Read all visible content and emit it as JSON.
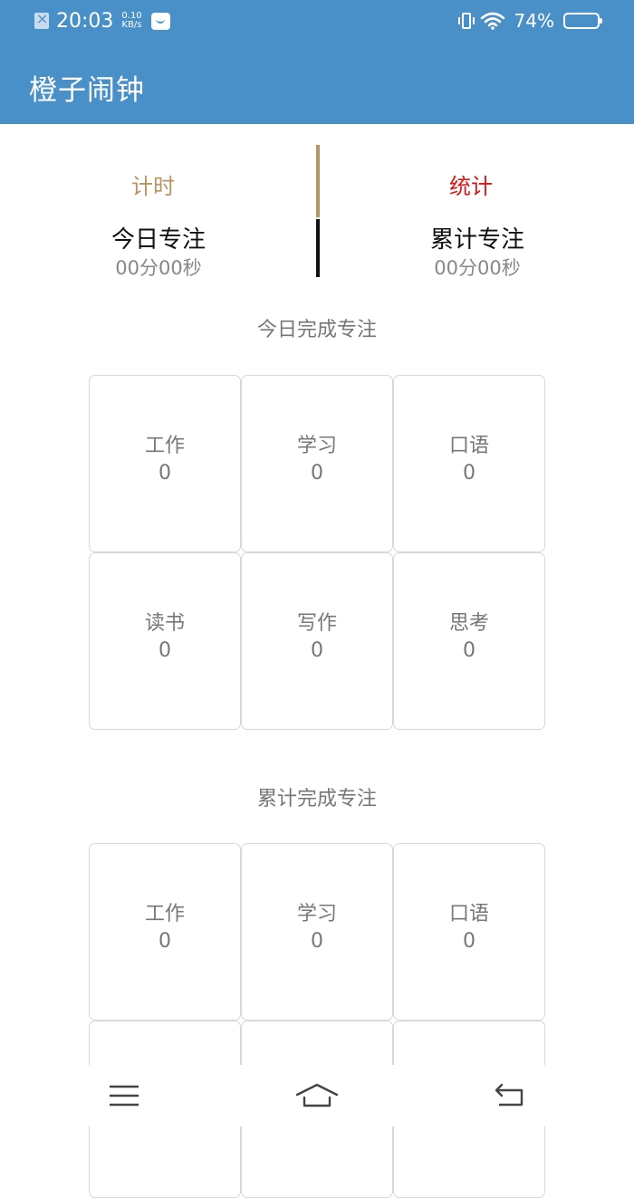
{
  "status_bar": {
    "time": "20:03",
    "speed_value": "0.10",
    "speed_unit": "KB/s",
    "battery": "74%",
    "icons": [
      "sim-error-icon",
      "message-icon",
      "vibrate-icon",
      "wifi-icon",
      "battery-icon"
    ]
  },
  "app": {
    "title": "橙子闹钟",
    "accent_color": "#4a90c8"
  },
  "tabs": {
    "timer": "计时",
    "stats": "统计",
    "timer_color": "#b89463",
    "stats_color": "#e01515"
  },
  "summary": {
    "today_title": "今日专注",
    "today_value": "00分00秒",
    "total_title": "累计专注",
    "total_value": "00分00秒"
  },
  "today_section": {
    "title": "今日完成专注",
    "items": [
      {
        "label": "工作",
        "count": "0"
      },
      {
        "label": "学习",
        "count": "0"
      },
      {
        "label": "口语",
        "count": "0"
      },
      {
        "label": "读书",
        "count": "0"
      },
      {
        "label": "写作",
        "count": "0"
      },
      {
        "label": "思考",
        "count": "0"
      }
    ]
  },
  "total_section": {
    "title": "累计完成专注",
    "items": [
      {
        "label": "工作",
        "count": "0"
      },
      {
        "label": "学习",
        "count": "0"
      },
      {
        "label": "口语",
        "count": "0"
      }
    ]
  },
  "nav": {
    "icons": [
      "menu-icon",
      "home-icon",
      "back-icon"
    ]
  }
}
